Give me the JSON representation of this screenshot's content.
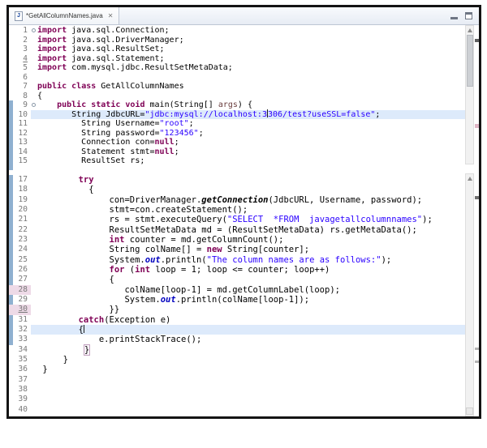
{
  "window": {
    "tab": {
      "title": "*GetAllColumnNames.java",
      "icon_letter": "J",
      "close_glyph": "✕"
    },
    "controls": {
      "minimize_label": "minimize",
      "maximize_label": "maximize"
    }
  },
  "colors": {
    "kw": "#7f0055",
    "str": "#2a00ff",
    "sfield": "#0000c0",
    "param": "#6a3e3e",
    "lnum": "#787878",
    "curline": "#ddeafb",
    "rangebar": "#8fb0d0",
    "numpink": "#eedae7",
    "winborder": "#141414",
    "tabbar1": "#f8fafd",
    "tabbar2": "#e7ecf4",
    "tabborder": "#bec6d3",
    "track": "#f1f1f1",
    "thumb": "#cdd0d4",
    "caret": "#1a1a1a"
  },
  "editor": {
    "lines": [
      {
        "n": "1",
        "f": 1,
        "seg": [
          [
            "k",
            "import"
          ],
          [
            "d",
            " java.sql.Connection;"
          ]
        ]
      },
      {
        "n": "2",
        "seg": [
          [
            "k",
            "import"
          ],
          [
            "d",
            " java.sql.DriverManager;"
          ]
        ]
      },
      {
        "n": "3",
        "seg": [
          [
            "k",
            "import"
          ],
          [
            "d",
            " java.sql.ResultSet;"
          ]
        ]
      },
      {
        "n": "4",
        "nu": 1,
        "seg": [
          [
            "k",
            "import"
          ],
          [
            "d",
            " java.sql.Statement;"
          ]
        ]
      },
      {
        "n": "5",
        "seg": [
          [
            "k",
            "import"
          ],
          [
            "d",
            " com.mysql.jdbc.ResultSetMetaData;"
          ]
        ]
      },
      {
        "n": "6",
        "seg": []
      },
      {
        "n": "7",
        "seg": [
          [
            "k",
            "public"
          ],
          [
            "d",
            " "
          ],
          [
            "k",
            "class"
          ],
          [
            "d",
            " GetAllColumnNames"
          ]
        ]
      },
      {
        "n": "8",
        "seg": [
          [
            "d",
            "{"
          ]
        ]
      },
      {
        "n": "9",
        "f": 1,
        "seg": [
          [
            "d",
            "    "
          ],
          [
            "k",
            "public"
          ],
          [
            "d",
            " "
          ],
          [
            "k",
            "static"
          ],
          [
            "d",
            " "
          ],
          [
            "k",
            "void"
          ],
          [
            "d",
            " main(String[] "
          ],
          [
            "p",
            "args"
          ],
          [
            "d",
            ") {"
          ]
        ]
      },
      {
        "n": "10",
        "hl": 1,
        "seg": [
          [
            "d",
            "       String JdbcURL="
          ],
          [
            "s",
            "\"jdbc:mysql://localhost:3"
          ],
          [
            "c",
            ""
          ],
          [
            "s",
            "306/test?useSSL=false\""
          ],
          [
            "d",
            ";"
          ]
        ]
      },
      {
        "n": "11",
        "seg": [
          [
            "d",
            "         String Username="
          ],
          [
            "s",
            "\"root\""
          ],
          [
            "d",
            ";"
          ]
        ]
      },
      {
        "n": "12",
        "seg": [
          [
            "d",
            "         String password="
          ],
          [
            "s",
            "\"123456\""
          ],
          [
            "d",
            ";"
          ]
        ]
      },
      {
        "n": "13",
        "seg": [
          [
            "d",
            "         Connection con="
          ],
          [
            "k",
            "null"
          ],
          [
            "d",
            ";"
          ]
        ]
      },
      {
        "n": "14",
        "seg": [
          [
            "d",
            "         Statement stmt="
          ],
          [
            "k",
            "null"
          ],
          [
            "d",
            ";"
          ]
        ]
      },
      {
        "n": "15",
        "seg": [
          [
            "d",
            "         ResultSet rs;"
          ]
        ]
      },
      {
        "n": "",
        "seg": []
      },
      {
        "n": "17",
        "seg": [
          [
            "d",
            "        "
          ],
          [
            "k",
            "try"
          ]
        ]
      },
      {
        "n": "18",
        "seg": [
          [
            "d",
            "          {"
          ]
        ]
      },
      {
        "n": "19",
        "seg": [
          [
            "d",
            "              con=DriverManager."
          ],
          [
            "m",
            "getConnection"
          ],
          [
            "d",
            "(JdbcURL, Username, password);"
          ]
        ]
      },
      {
        "n": "20",
        "seg": [
          [
            "d",
            "              stmt=con.createStatement();"
          ]
        ]
      },
      {
        "n": "21",
        "seg": [
          [
            "d",
            "              rs = stmt.executeQuery("
          ],
          [
            "s",
            "\"SELECT  *FROM  javagetallcolumnnames\""
          ],
          [
            "d",
            ");"
          ]
        ]
      },
      {
        "n": "22",
        "seg": [
          [
            "d",
            "              ResultSetMetaData md = (ResultSetMetaData) rs.getMetaData();"
          ]
        ]
      },
      {
        "n": "23",
        "seg": [
          [
            "d",
            "              "
          ],
          [
            "k",
            "int"
          ],
          [
            "d",
            " counter = md.getColumnCount();"
          ]
        ]
      },
      {
        "n": "24",
        "seg": [
          [
            "d",
            "              String colName[] = "
          ],
          [
            "k",
            "new"
          ],
          [
            "d",
            " String[counter];"
          ]
        ]
      },
      {
        "n": "25",
        "seg": [
          [
            "d",
            "              System."
          ],
          [
            "o",
            "out"
          ],
          [
            "d",
            ".println("
          ],
          [
            "s",
            "\"The column names are as follows:\""
          ],
          [
            "d",
            ");"
          ]
        ]
      },
      {
        "n": "26",
        "seg": [
          [
            "d",
            "              "
          ],
          [
            "k",
            "for"
          ],
          [
            "d",
            " ("
          ],
          [
            "k",
            "int"
          ],
          [
            "d",
            " loop = 1; loop <= counter; loop++)"
          ]
        ]
      },
      {
        "n": "27",
        "seg": [
          [
            "d",
            "              {"
          ]
        ]
      },
      {
        "n": "28",
        "np": 1,
        "seg": [
          [
            "d",
            "                 colName[loop-1] = md.getColumnLabel(loop);"
          ]
        ]
      },
      {
        "n": "29",
        "seg": [
          [
            "d",
            "                 System."
          ],
          [
            "o",
            "out"
          ],
          [
            "d",
            ".println(colName[loop-1]);"
          ]
        ]
      },
      {
        "n": "30",
        "np": 1,
        "nu": 1,
        "seg": [
          [
            "d",
            "              }}"
          ]
        ]
      },
      {
        "n": "31",
        "seg": [
          [
            "d",
            "        "
          ],
          [
            "k",
            "catch"
          ],
          [
            "d",
            "(Exception e)"
          ]
        ]
      },
      {
        "n": "32",
        "hl": 1,
        "seg": [
          [
            "d",
            "        {"
          ],
          [
            "c",
            ""
          ]
        ]
      },
      {
        "n": "33",
        "seg": [
          [
            "d",
            "            e.printStackTrace();"
          ]
        ]
      },
      {
        "n": "34",
        "seg": [
          [
            "d",
            "         "
          ],
          [
            "x",
            "}"
          ]
        ]
      },
      {
        "n": "35",
        "seg": [
          [
            "d",
            "     }"
          ]
        ]
      },
      {
        "n": "36",
        "seg": [
          [
            "d",
            " }"
          ]
        ]
      },
      {
        "n": "37",
        "seg": []
      },
      {
        "n": "38",
        "seg": []
      },
      {
        "n": "39",
        "seg": []
      },
      {
        "n": "40",
        "seg": []
      }
    ]
  }
}
